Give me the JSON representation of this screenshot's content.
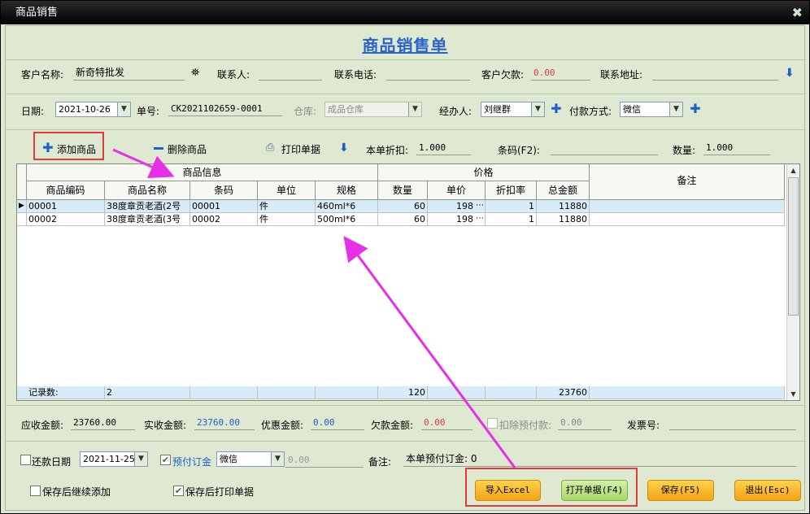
{
  "window": {
    "title": "商品销售",
    "close_glyph": "✖"
  },
  "heading": "商品销售单",
  "row1": {
    "customer_label": "客户名称:",
    "customer_value": "新奇特批发",
    "contact_label": "联系人:",
    "contact_value": "",
    "phone_label": "联系电话:",
    "phone_value": "",
    "debt_label": "客户欠款:",
    "debt_value": "0.00",
    "address_label": "联系地址:",
    "address_value": ""
  },
  "row2": {
    "date_label": "日期:",
    "date_value": "2021-10-26",
    "order_label": "单号:",
    "order_value": "CK2021102659-0001",
    "warehouse_label": "仓库:",
    "warehouse_value": "成品仓库",
    "handler_label": "经办人:",
    "handler_value": "刘继群",
    "pay_label": "付款方式:",
    "pay_value": "微信"
  },
  "toolbar": {
    "add_label": "添加商品",
    "delete_label": "删除商品",
    "print_label": "打印单据",
    "discount_label": "本单折扣:",
    "discount_value": "1.000",
    "barcode_label": "条码(F2):",
    "barcode_value": "",
    "qty_label": "数量:",
    "qty_value": "1.000"
  },
  "grid": {
    "group_product": "商品信息",
    "group_price": "价格",
    "remark": "备注",
    "columns": [
      "商品编码",
      "商品名称",
      "条码",
      "单位",
      "规格",
      "数量",
      "单价",
      "折扣率",
      "总金额"
    ],
    "rows": [
      {
        "code": "00001",
        "name": "38度章贡老酒(2号",
        "barcode": "00001",
        "unit": "件",
        "spec": "460ml*6",
        "qty": "60",
        "price": "198",
        "rate": "1",
        "total": "11880"
      },
      {
        "code": "00002",
        "name": "38度章贡老酒(3号",
        "barcode": "00002",
        "unit": "件",
        "spec": "500ml*6",
        "qty": "60",
        "price": "198",
        "rate": "1",
        "total": "11880"
      }
    ],
    "summary": {
      "label": "记录数:",
      "count": "2",
      "qty": "120",
      "total": "23760"
    }
  },
  "totals": {
    "receivable_label": "应收金额:",
    "receivable_value": "23760.00",
    "received_label": "实收金额:",
    "received_value": "23760.00",
    "discount_amt_label": "优惠金额:",
    "discount_amt_value": "0.00",
    "owe_label": "欠款金额:",
    "owe_value": "0.00",
    "deduct_label": "扣除预付款:",
    "deduct_value": "0.00",
    "invoice_label": "发票号:",
    "invoice_value": ""
  },
  "row_bottom": {
    "repay_label": "还款日期",
    "repay_date": "2021-11-25",
    "prepay_label": "预付订金",
    "prepay_method": "微信",
    "prepay_amount": "0.00",
    "remark_label": "备注:",
    "remark_value": "本单预付订金: 0"
  },
  "options": {
    "continue_label": "保存后继续添加",
    "print_after_label": "保存后打印单据"
  },
  "buttons": {
    "excel": "导入Excel",
    "open": "打开单据(F4)",
    "save": "保存(F5)",
    "exit": "退出(Esc)"
  },
  "colors": {
    "accent": "#2a63c9",
    "warning": "#e33b3b",
    "annotation": "#e62fe6",
    "background": "#dfe9d2"
  }
}
